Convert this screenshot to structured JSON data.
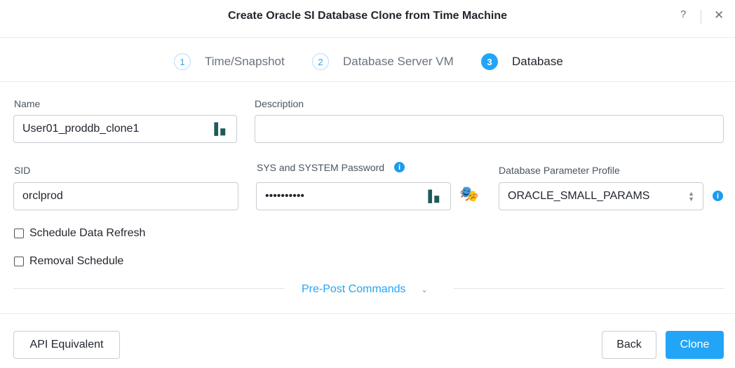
{
  "dialog": {
    "title": "Create Oracle SI Database Clone from Time Machine",
    "help": "?",
    "close": "✕"
  },
  "steps": [
    {
      "num": "1",
      "label": "Time/Snapshot"
    },
    {
      "num": "2",
      "label": "Database Server VM"
    },
    {
      "num": "3",
      "label": "Database"
    }
  ],
  "form": {
    "name_label": "Name",
    "name_value": "User01_proddb_clone1",
    "description_label": "Description",
    "description_value": "",
    "sid_label": "SID",
    "sid_value": "orclprod",
    "password_label": "SYS and SYSTEM Password",
    "password_value": "••••••••••",
    "profile_label": "Database Parameter Profile",
    "profile_value": "ORACLE_SMALL_PARAMS",
    "schedule_refresh": "Schedule Data Refresh",
    "removal_schedule": "Removal Schedule",
    "pre_post": "Pre-Post Commands"
  },
  "footer": {
    "api": "API Equivalent",
    "back": "Back",
    "clone": "Clone"
  },
  "colors": {
    "accent": "#22a5f7"
  }
}
